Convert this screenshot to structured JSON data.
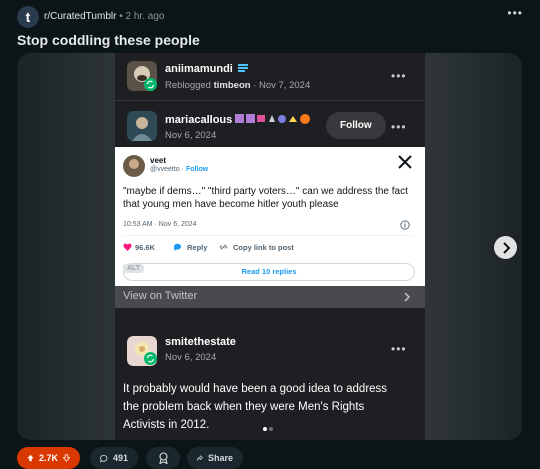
{
  "post": {
    "subreddit": "r/CuratedTumblr",
    "separator": "•",
    "age": "2 hr. ago",
    "title": "Stop coddling these people",
    "more": "•••"
  },
  "gallery": {
    "reblog": {
      "username": "aniimamundi",
      "meta_prefix": "Reblogged",
      "reblogged_from": "timbeon",
      "date": "Nov 7, 2024",
      "more": "•••"
    },
    "op": {
      "username": "mariacallous",
      "date": "Nov 6, 2024",
      "follow_label": "Follow",
      "more": "•••"
    },
    "tweet": {
      "name": "veet",
      "handle": "@vveetto",
      "follow": "Follow",
      "text": "\"maybe if dems…\" \"third party voters…\" can we address the fact that young men have become hitler youth please",
      "timestamp": "10:53 AM · Nov 6, 2024",
      "likes": "96.6K",
      "reply_label": "Reply",
      "copy_label": "Copy link to post",
      "read_replies": "Read 10 replies",
      "alt": "ALT"
    },
    "view_on_twitter": "View on Twitter",
    "reply": {
      "username": "smitethestate",
      "date": "Nov 6, 2024",
      "more": "•••",
      "text": "It probably would have been a good idea to address the problem back when they were Men's Rights Activists in 2012."
    },
    "page_indicator": {
      "current": 1,
      "total": 2
    }
  },
  "actions": {
    "votes": "2.7K",
    "comments": "491",
    "share": "Share"
  },
  "colors": {
    "background": "#0b1416",
    "upvote_active": "#d93900",
    "tumblr_green": "#00b86b",
    "twitter_blue": "#1d9bf0"
  }
}
